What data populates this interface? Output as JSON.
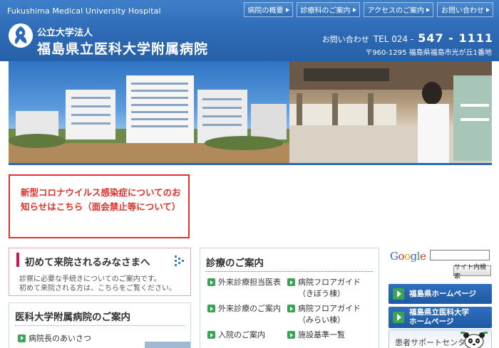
{
  "header": {
    "top_name": "Fukushima Medical University Hospital",
    "nav": [
      "病院の概要",
      "診療科のご案内",
      "アクセスのご案内",
      "お問い合わせ"
    ],
    "org_sub": "公立大学法人",
    "org_name": "福島県立医科大学附属病院",
    "contact_label": "お問い合わせ",
    "contact_tel": "TEL 024 -",
    "contact_number": "547 - 1111",
    "address": "〒960-1295 福島県福島市光が丘1番地"
  },
  "notice": {
    "text": "新型コロナウイルス感染症についてのお知らせはこちら（面会禁止等について）"
  },
  "first_visit": {
    "title": "初めて来院されるみなさまへ",
    "line1": "診察に必要な手続きについてのご案内です。",
    "line2": "初めて来院される方は、こちらをご覧ください。"
  },
  "hospital_guide": {
    "title": "医科大学附属病院のご案内",
    "items": [
      "病院長のあいさつ"
    ]
  },
  "clinical": {
    "title": "診療のご案内",
    "left_items": [
      "外来診療担当医表",
      "外来診療のご案内",
      "入院のご案内"
    ],
    "right_items": [
      {
        "line1": "病院フロアガイド",
        "line2": "（きぼう棟）"
      },
      {
        "line1": "病院フロアガイド",
        "line2": "（みらい棟）"
      },
      {
        "line1": "施設基準一覧",
        "line2": ""
      }
    ]
  },
  "sidebar": {
    "google": "Google",
    "search_placeholder": "",
    "search_button": "サイト内検索",
    "buttons": [
      {
        "line1": "福島県ホームページ",
        "line2": ""
      },
      {
        "line1": "福島県立医科大学",
        "line2": "ホームページ"
      }
    ],
    "support": "患者サポートセンター"
  },
  "colors": {
    "header_blue": "#2d69b4",
    "notice_red": "#e0322c",
    "accent_pink": "#d4145a",
    "arrow_green": "#3aa356"
  }
}
